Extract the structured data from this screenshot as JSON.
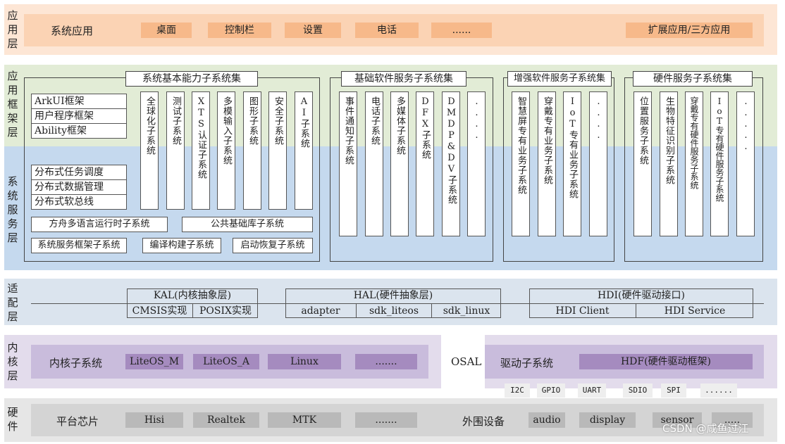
{
  "layers": {
    "app": "应用层",
    "framework": "应用框架层",
    "system_service": "系统服务层",
    "adapter": "适配层",
    "kernel": "内核层",
    "hardware": "硬件"
  },
  "app_layer": {
    "label": "系统应用",
    "items": [
      "桌面",
      "控制栏",
      "设置",
      "电话",
      "......"
    ],
    "extension": "扩展应用/三方应用"
  },
  "basic_capability": {
    "title": "系统基本能力子系统集",
    "frameworks": [
      "ArkUI框架",
      "用户程序框架",
      "Ability框架"
    ],
    "distributed": [
      "分布式任务调度",
      "分布式数据管理",
      "分布式软总线"
    ],
    "subsystems": [
      "全球化子系统",
      "测试子系统",
      "XTS认证子系统",
      "多模输入子系统",
      "图形子系统",
      "安全子系统",
      "AI子系统"
    ],
    "bottom_row1": [
      "方舟多语言运行时子系统",
      "公共基础库子系统"
    ],
    "bottom_row2": [
      "系统服务框架子系统",
      "编译构建子系统",
      "启动恢复子系统"
    ]
  },
  "basic_software": {
    "title": "基础软件服务子系统集",
    "subsystems": [
      "事件通知子系统",
      "电话子系统",
      "多媒体子系统",
      "DFX子系统",
      "DMDP&DV子系统",
      "...."
    ]
  },
  "enhanced_software": {
    "title": "增强软件服务子系统集",
    "subsystems": [
      "智慧屏专有业务子系统",
      "穿戴专有业务子系统",
      "IoT专有业务子系统",
      "...."
    ]
  },
  "hardware_service": {
    "title": "硬件服务子系统集",
    "subsystems": [
      "位置服务子系统",
      "生物特征识别子系统",
      "穿戴专有硬件服务子系统",
      "IoT专有硬件服务子系统",
      "....."
    ]
  },
  "adapter_layer": {
    "kal": {
      "title": "KAL(内核抽象层)",
      "items": [
        "CMSIS实现",
        "POSIX实现"
      ]
    },
    "hal": {
      "title": "HAL(硬件抽象层)",
      "items": [
        "adapter",
        "sdk_liteos",
        "sdk_linux"
      ]
    },
    "hdi": {
      "title": "HDI(硬件驱动接口)",
      "items": [
        "HDI Client",
        "HDI Service"
      ]
    }
  },
  "kernel_layer": {
    "label": "内核子系统",
    "items": [
      "LiteOS_M",
      "LiteOS_A",
      "Linux",
      "......."
    ],
    "osal": "OSAL",
    "driver_label": "驱动子系统",
    "hdf": "HDF(硬件驱动框架)",
    "buses": [
      "I2C",
      "GPIO",
      "UART",
      "SDIO",
      "SPI",
      "......"
    ]
  },
  "hardware_layer": {
    "chip_label": "平台芯片",
    "chips": [
      "Hisi",
      "Realtek",
      "MTK",
      "......."
    ],
    "peripheral_label": "外围设备",
    "peripherals": [
      "audio",
      "display",
      "sensor",
      "....."
    ]
  },
  "watermark": "CSDN @咸鱼过江",
  "colors": {
    "app_band": "#fde6d5",
    "app_inner": "#fbd3b4",
    "app_cell": "#f7b98a",
    "framework_band": "#e2ecd6",
    "service_band": "#c5d9ee",
    "adapter_band": "#dbe4ee",
    "kernel_band": "#e3dcec",
    "kernel_inner": "#c9bcdc",
    "kernel_cell": "#a58bbf",
    "hardware_band": "#e6e6e6",
    "hardware_inner": "#d4d4d4",
    "hardware_cell": "#b9b9b9"
  }
}
